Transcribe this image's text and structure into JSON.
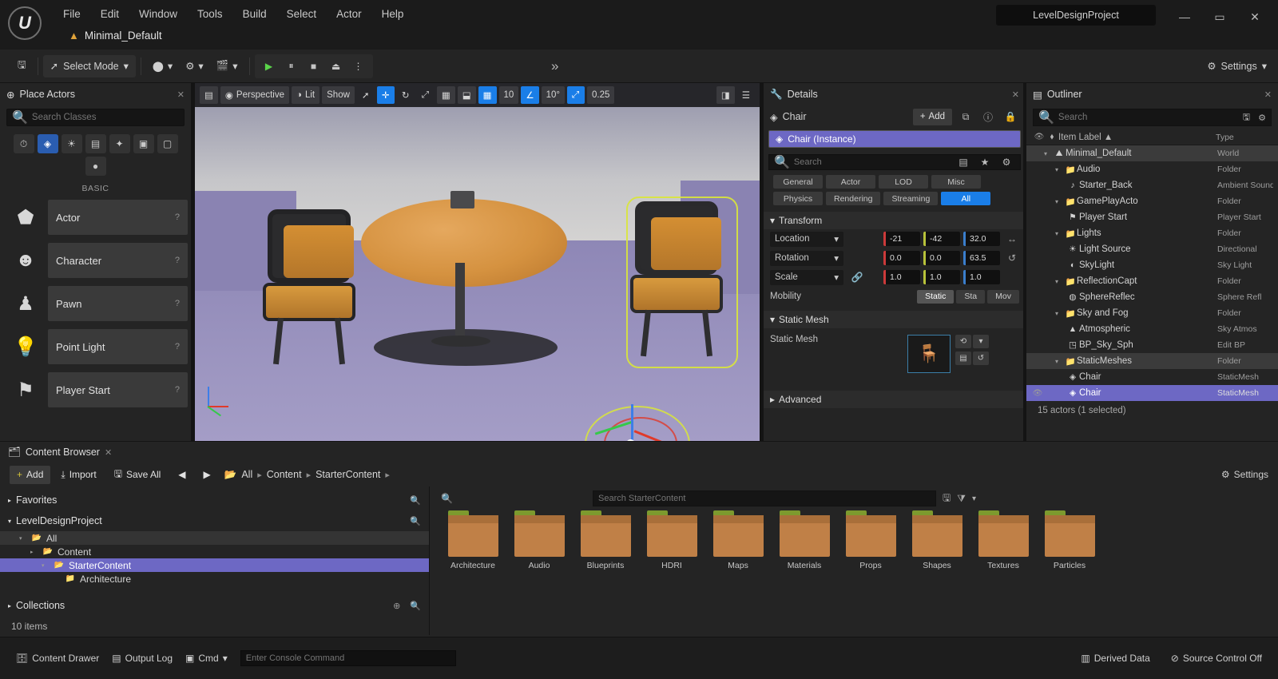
{
  "window": {
    "project_title": "LevelDesignProject",
    "minimize": "—",
    "maximize": "▭",
    "close": "✕"
  },
  "menubar": {
    "items": [
      "File",
      "Edit",
      "Window",
      "Tools",
      "Build",
      "Select",
      "Actor",
      "Help"
    ]
  },
  "level_tab": {
    "label": "Minimal_Default"
  },
  "toolbar": {
    "save_label": "Save",
    "mode_label": "Select Mode",
    "create_label": "Create",
    "blueprints_label": "Blueprints",
    "cinematics_label": "Cinematics",
    "play_label": "Play",
    "settings_label": "Settings"
  },
  "place_actors": {
    "title": "Place Actors",
    "close": "✕",
    "search_placeholder": "Search Classes",
    "search_value": "",
    "category_label": "BASIC",
    "categories": [
      {
        "name": "recently-placed",
        "glyph": "⏱"
      },
      {
        "name": "basic",
        "glyph": "◈"
      },
      {
        "name": "lights",
        "glyph": "☀"
      },
      {
        "name": "cinematic",
        "glyph": "▤"
      },
      {
        "name": "visual-effects",
        "glyph": "✦"
      },
      {
        "name": "geometry",
        "glyph": "▣"
      },
      {
        "name": "volumes",
        "glyph": "▢"
      },
      {
        "name": "all-classes",
        "glyph": "●"
      }
    ],
    "items": [
      {
        "label": "Actor",
        "glyph": "⬟",
        "help": "?"
      },
      {
        "label": "Character",
        "glyph": "☻",
        "help": "?"
      },
      {
        "label": "Pawn",
        "glyph": "♟",
        "help": "?"
      },
      {
        "label": "Point Light",
        "glyph": "💡",
        "help": "?"
      },
      {
        "label": "Player Start",
        "glyph": "⚑",
        "help": "?"
      }
    ]
  },
  "viewport": {
    "perspective_label": "Perspective",
    "lit_label": "Lit",
    "show_label": "Show",
    "menu_glyph": "▤",
    "camera_glyph": "◉",
    "buttons": [
      {
        "name": "select-tool",
        "glyph": "➚",
        "active": false
      },
      {
        "name": "move-tool",
        "glyph": "✛",
        "active": true
      },
      {
        "name": "rotate-tool",
        "glyph": "↻",
        "active": false
      },
      {
        "name": "scale-tool",
        "glyph": "⤢",
        "active": false
      },
      {
        "name": "coordinate-system",
        "glyph": "▦",
        "active": false
      },
      {
        "name": "surface-snap",
        "glyph": "⬓",
        "active": false
      },
      {
        "name": "grid-snap",
        "glyph": "▦",
        "active": true
      },
      {
        "name": "grid-size",
        "glyph": "10",
        "active": false
      },
      {
        "name": "angle-snap",
        "glyph": "∠",
        "active": true
      },
      {
        "name": "angle-size",
        "glyph": "10°",
        "active": false
      },
      {
        "name": "scale-snap",
        "glyph": "⤢",
        "active": true
      },
      {
        "name": "scale-size",
        "glyph": "0.25",
        "active": false
      },
      {
        "name": "camera-speed",
        "glyph": "◨",
        "active": false
      },
      {
        "name": "viewport-options",
        "glyph": "☰",
        "active": false
      }
    ]
  },
  "details": {
    "title": "Details",
    "close": "✕",
    "object_name": "Chair",
    "add_label": "Add",
    "selected_actor": "Chair (Instance)",
    "search_placeholder": "Search",
    "search_value": "",
    "filter_chips": [
      {
        "label": "General",
        "active": false
      },
      {
        "label": "Actor",
        "active": false
      },
      {
        "label": "LOD",
        "active": false
      },
      {
        "label": "Misc",
        "active": false
      },
      {
        "label": "Physics",
        "active": false
      },
      {
        "label": "Rendering",
        "active": false
      },
      {
        "label": "Streaming",
        "active": false
      },
      {
        "label": "All",
        "active": true
      }
    ],
    "transform_section": "Transform",
    "rows": [
      {
        "label": "Location",
        "x": "-21",
        "y": "-42",
        "z": "32.0",
        "trail": "↔"
      },
      {
        "label": "Rotation",
        "x": "0.0",
        "y": "0.0",
        "z": "63.5",
        "trail": "↺"
      },
      {
        "label": "Scale",
        "x": "1.0",
        "y": "1.0",
        "z": "1.0",
        "trail": ""
      }
    ],
    "mobility_label": "Mobility",
    "mobility_options": [
      {
        "label": "Static",
        "active": true
      },
      {
        "label": "Sta",
        "active": false
      },
      {
        "label": "Mov",
        "active": false
      }
    ],
    "static_mesh_section": "Static Mesh",
    "static_mesh_label": "Static Mesh",
    "advanced_section": "Advanced"
  },
  "outliner": {
    "title": "Outliner",
    "close": "✕",
    "search_placeholder": "Search",
    "search_value": "",
    "col_label": "Item Label",
    "col_type": "Type",
    "sort_arrow": "▲",
    "status": "15 actors (1 selected)",
    "rows": [
      {
        "label": "Minimal_Default",
        "type": "World",
        "depth": 0,
        "arrow": "▾",
        "icon": "⛰",
        "state": "hl"
      },
      {
        "label": "Audio",
        "type": "Folder",
        "depth": 1,
        "arrow": "▾",
        "icon": "📁",
        "state": ""
      },
      {
        "label": "Starter_Back",
        "type": "Ambient Sound",
        "depth": 2,
        "arrow": "",
        "icon": "♪",
        "state": ""
      },
      {
        "label": "GamePlayActo",
        "type": "Folder",
        "depth": 1,
        "arrow": "▾",
        "icon": "📁",
        "state": ""
      },
      {
        "label": "Player Start",
        "type": "Player Start",
        "depth": 2,
        "arrow": "",
        "icon": "⚑",
        "state": ""
      },
      {
        "label": "Lights",
        "type": "Folder",
        "depth": 1,
        "arrow": "▾",
        "icon": "📁",
        "state": ""
      },
      {
        "label": "Light Source",
        "type": "Directional",
        "depth": 2,
        "arrow": "",
        "icon": "☀",
        "state": ""
      },
      {
        "label": "SkyLight",
        "type": "Sky Light",
        "depth": 2,
        "arrow": "",
        "icon": "◐",
        "state": ""
      },
      {
        "label": "ReflectionCapt",
        "type": "Folder",
        "depth": 1,
        "arrow": "▾",
        "icon": "📁",
        "state": ""
      },
      {
        "label": "SphereReflec",
        "type": "Sphere Refl",
        "depth": 2,
        "arrow": "",
        "icon": "◍",
        "state": ""
      },
      {
        "label": "Sky and Fog",
        "type": "Folder",
        "depth": 1,
        "arrow": "▾",
        "icon": "📁",
        "state": ""
      },
      {
        "label": "Atmospheric",
        "type": "Sky Atmos",
        "depth": 2,
        "arrow": "",
        "icon": "▲",
        "state": ""
      },
      {
        "label": "BP_Sky_Sph",
        "type": "Edit BP",
        "depth": 2,
        "arrow": "",
        "icon": "◳",
        "state": ""
      },
      {
        "label": "StaticMeshes",
        "type": "Folder",
        "depth": 1,
        "arrow": "▾",
        "icon": "📁",
        "state": "hl"
      },
      {
        "label": "Chair",
        "type": "StaticMesh",
        "depth": 2,
        "arrow": "",
        "icon": "◈",
        "state": ""
      },
      {
        "label": "Chair",
        "type": "StaticMesh",
        "depth": 2,
        "arrow": "",
        "icon": "◈",
        "state": "sel"
      }
    ]
  },
  "content_browser": {
    "title": "Content Browser",
    "close": "✕",
    "add_label": "Add",
    "import_label": "Import",
    "save_all_label": "Save All",
    "settings_label": "Settings",
    "breadcrumb": [
      "All",
      "Content",
      "StarterContent"
    ],
    "search_placeholder": "Search StarterContent",
    "search_value": "",
    "item_count": "10 items",
    "sources": {
      "favorites": "Favorites",
      "project": "LevelDesignProject",
      "collections": "Collections",
      "tree": [
        {
          "label": "All",
          "depth": 0,
          "arrow": "▾",
          "icon": "📂",
          "state": "hl"
        },
        {
          "label": "Content",
          "depth": 1,
          "arrow": "▸",
          "icon": "📂",
          "state": ""
        },
        {
          "label": "StarterContent",
          "depth": 2,
          "arrow": "▾",
          "icon": "📂",
          "state": "sel"
        },
        {
          "label": "Architecture",
          "depth": 3,
          "arrow": "",
          "icon": "📁",
          "state": ""
        }
      ]
    },
    "tiles": [
      {
        "label": "Architecture"
      },
      {
        "label": "Audio"
      },
      {
        "label": "Blueprints"
      },
      {
        "label": "HDRI"
      },
      {
        "label": "Maps"
      },
      {
        "label": "Materials"
      },
      {
        "label": "Props"
      },
      {
        "label": "Shapes"
      },
      {
        "label": "Textures"
      },
      {
        "label": "Particles"
      }
    ]
  },
  "statusbar": {
    "content_drawer": "Content Drawer",
    "output_log": "Output Log",
    "cmd_label": "Cmd",
    "cmd_placeholder": "Enter Console Command",
    "cmd_value": "",
    "derived_data": "Derived Data",
    "source_control": "Source Control Off"
  },
  "colors": {
    "accent_blue": "#1a7ee8",
    "selection_purple": "#6d68c4",
    "panel_bg": "#242424",
    "window_bg": "#1b1b1b",
    "folder_orange": "#c08047"
  }
}
